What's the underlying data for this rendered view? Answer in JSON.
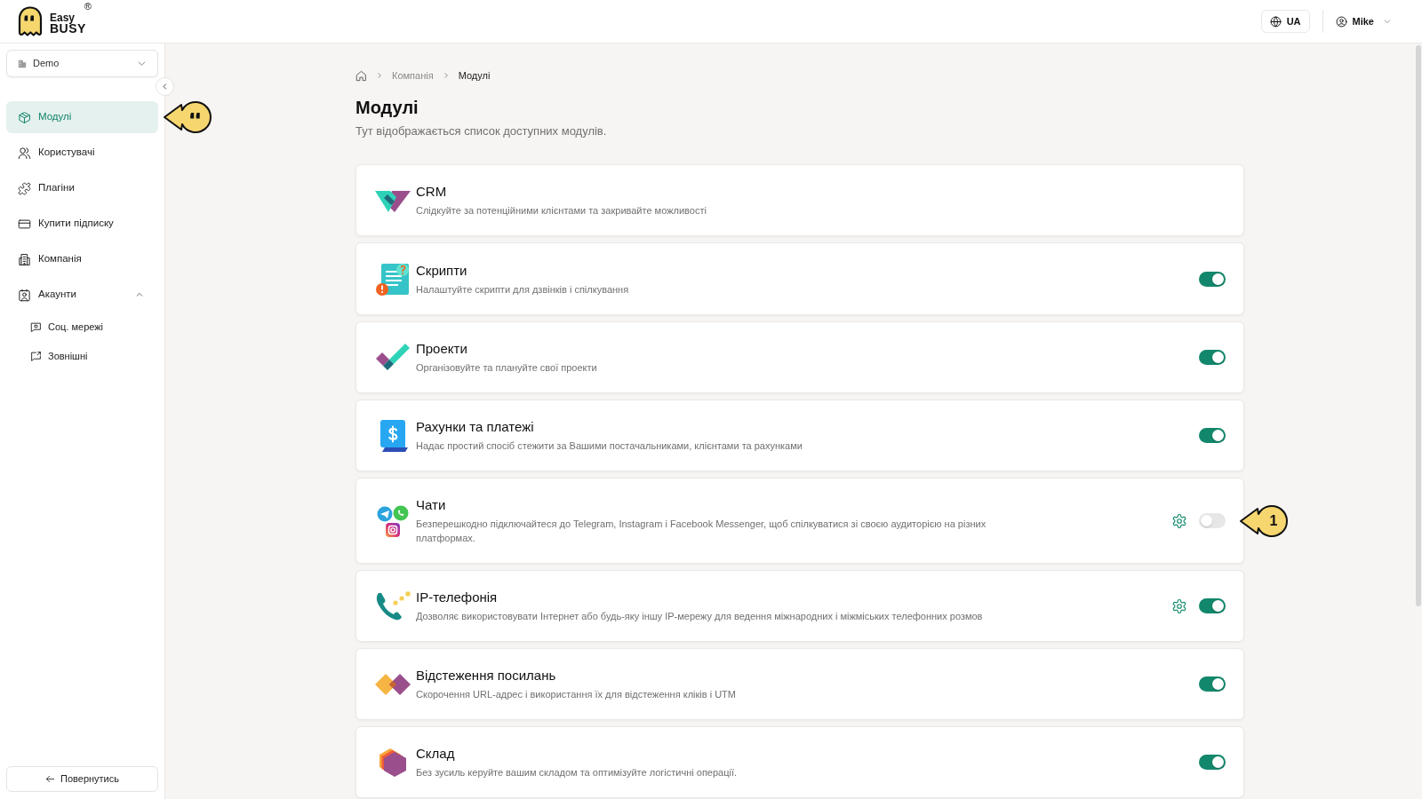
{
  "header": {
    "logo": {
      "line_1": "Easy",
      "line_2": "BUSY",
      "mark": "®"
    },
    "language_button": {
      "label": "UA"
    },
    "user_menu": {
      "name": "Mike"
    }
  },
  "sidebar": {
    "workspace_select": {
      "value": "Demo"
    },
    "items": [
      {
        "label": "Модулі",
        "selected": true,
        "pointer": true
      },
      {
        "label": "Користувачі",
        "selected": false,
        "pointer": false
      },
      {
        "label": "Плагіни",
        "selected": false,
        "pointer": false
      },
      {
        "label": "Купити підписку",
        "selected": false,
        "pointer": false
      },
      {
        "label": "Компанія",
        "selected": false,
        "pointer": false
      },
      {
        "label": "Акаунти",
        "selected": false,
        "pointer": false,
        "expanded": true,
        "children": [
          {
            "label": "Соц. мережі",
            "selected": false
          },
          {
            "label": "Зовнішні",
            "selected": false
          }
        ]
      }
    ],
    "back_button": {
      "label": "Повернутись"
    }
  },
  "breadcrumbs": [
    {
      "label": "Компанія",
      "current": false
    },
    {
      "label": "Модулі",
      "current": true
    }
  ],
  "page": {
    "title": "Модулі",
    "subtitle": "Тут відображається список доступних модулів."
  },
  "modules": [
    {
      "name": "CRM",
      "description": "Слідкуйте за потенційними клієнтами та закривайте можливості",
      "kind": "core",
      "settings": false
    },
    {
      "name": "Скрипти",
      "description": "Налаштуйте скрипти для дзвінків і спілкування",
      "kind": "optional",
      "on": true,
      "settings": false
    },
    {
      "name": "Проекти",
      "description": "Організовуйте та плануйте свої проекти",
      "kind": "optional",
      "on": true,
      "settings": false
    },
    {
      "name": "Рахунки та платежі",
      "description": "Надає простий спосіб стежити за Вашими постачальниками, клієнтами та рахунками",
      "kind": "optional",
      "on": true,
      "settings": false
    },
    {
      "name": "Чати",
      "description": "Безперешкодно підключайтеся до Telegram, Instagram і Facebook Messenger, щоб спілкуватися зі своєю аудиторією на різних платформах.",
      "kind": "optional",
      "on": false,
      "settings": true,
      "marker": {
        "label": "1"
      }
    },
    {
      "name": "IP-телефонія",
      "description": "Дозволяє використовувати Інтернет або будь-яку іншу IP-мережу для ведення міжнародних і міжміських телефонних розмов",
      "kind": "optional",
      "on": true,
      "settings": true
    },
    {
      "name": "Відстеження посилань",
      "description": "Скорочення URL-адрес і використання їх для відстеження кліків і UTM",
      "kind": "optional",
      "on": true,
      "settings": false
    },
    {
      "name": "Склад",
      "description": "Без зусиль керуйте вашим складом та оптимізуйте логістичні операції.",
      "kind": "optional",
      "on": true,
      "settings": false
    }
  ]
}
